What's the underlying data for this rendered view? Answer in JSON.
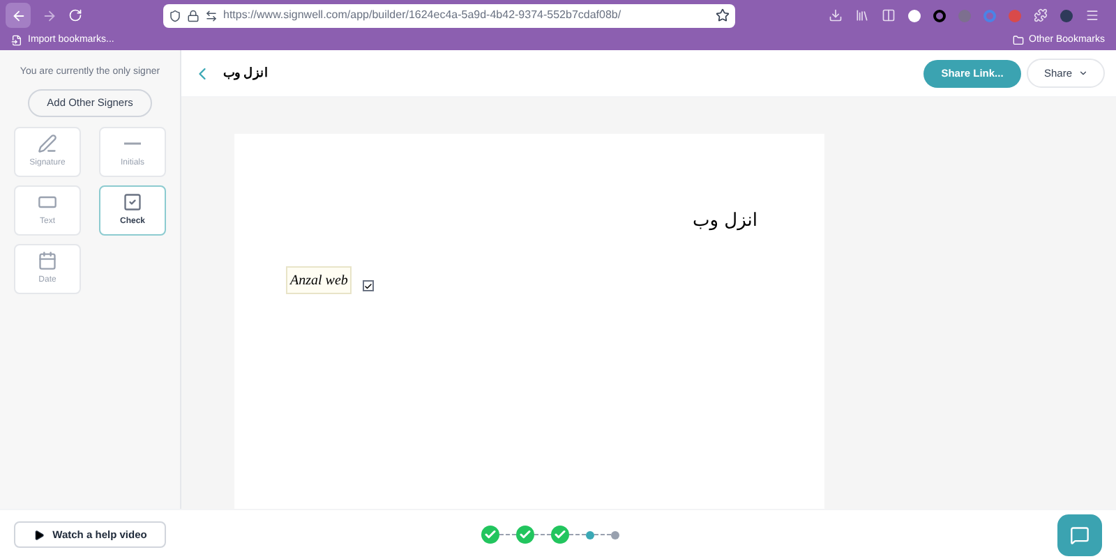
{
  "browser": {
    "url": "https://www.signwell.com/app/builder/1624ec4a-5a9d-4b42-9374-552b7cdaf08b/",
    "bookmarks": [
      {
        "label": "Import bookmarks..."
      }
    ],
    "other_bookmarks": "Other Bookmarks"
  },
  "sidebar": {
    "note": "You are currently the only signer",
    "add_button": "Add Other Signers",
    "tools": [
      {
        "kind": "signature",
        "label": "Signature",
        "selected": false
      },
      {
        "kind": "initials",
        "label": "Initials",
        "selected": false
      },
      {
        "kind": "text",
        "label": "Text",
        "selected": false
      },
      {
        "kind": "check",
        "label": "Check",
        "selected": true
      },
      {
        "kind": "date",
        "label": "Date",
        "selected": false
      }
    ]
  },
  "header": {
    "title": "انزل وب",
    "share_link": "Share Link...",
    "share": "Share"
  },
  "document": {
    "heading": "انزل وب",
    "signature": "Anzal web",
    "checkbox": {
      "checked": true
    }
  },
  "footer": {
    "help": "Watch a help video",
    "steps": [
      {
        "completed": true,
        "selected": false
      },
      {
        "completed": true,
        "selected": false
      },
      {
        "completed": true,
        "selected": false
      },
      {
        "completed": false,
        "selected": true
      },
      {
        "completed": false,
        "selected": false
      }
    ]
  }
}
